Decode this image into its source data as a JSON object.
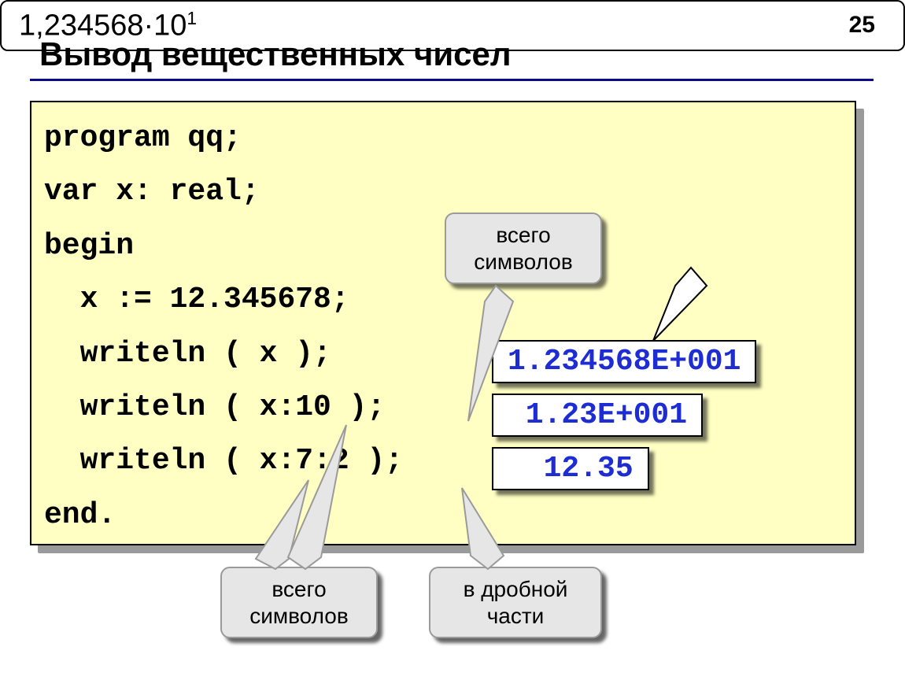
{
  "page_number": "25",
  "title": "Вывод вещественных чисел",
  "code": "program qq;\nvar x: real;\nbegin\n  x := 12.345678;\n  writeln ( x );\n  writeln ( x:10 );\n  writeln ( x:7:2 );\nend.",
  "callouts": {
    "total_chars_top": "всего\nсимволов",
    "result_top_mantissa": "1,234568·10",
    "result_top_exponent": "1",
    "total_chars_bottom": "всего\nсимволов",
    "fraction": "в дробной\nчасти"
  },
  "outputs": {
    "line1": "1.234568E+001",
    "line2": " 1.23E+001",
    "line3": "  12.35"
  }
}
